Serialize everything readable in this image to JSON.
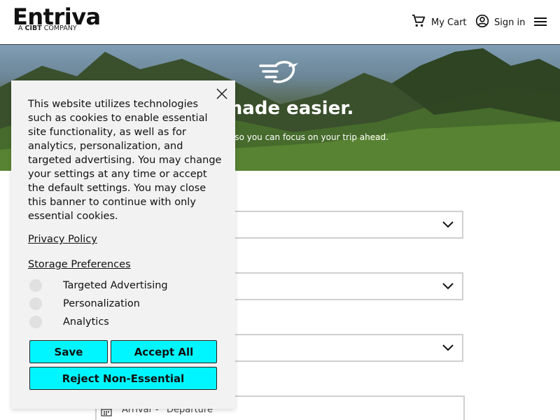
{
  "header": {
    "logo_text": "Entriva",
    "logo_sub_prefix": "A",
    "logo_sub_brand": "CIBT",
    "logo_sub_suffix": "COMPANY",
    "cart_label": "My Cart",
    "signin_label": "Sign in",
    "icons": {
      "cart": "cart-icon",
      "user": "user-circle-icon",
      "menu": "hamburger-menu-icon"
    }
  },
  "hero": {
    "title": "s made easier.",
    "subtitle": "business visas so you can focus on your trip ahead.",
    "icon": "bird-logo-icon"
  },
  "form": {
    "date": {
      "arrival_label": "Arrival",
      "separator": "-",
      "departure_label": "Departure"
    }
  },
  "cookie_banner": {
    "text": "This website utilizes technologies such as cookies to enable essential site functionality, as well as for analytics, personalization, and targeted advertising. You may change your settings at any time or accept the default settings. You may close this banner to continue with only essential cookies.",
    "privacy_link": "Privacy Policy",
    "storage_link": "Storage Preferences",
    "toggles": [
      {
        "label": "Targeted Advertising",
        "on": false
      },
      {
        "label": "Personalization",
        "on": false
      },
      {
        "label": "Analytics",
        "on": false
      }
    ],
    "save_label": "Save",
    "accept_label": "Accept All",
    "reject_label": "Reject Non-Essential"
  },
  "colors": {
    "button_accent": "#00f6ff",
    "banner_bg": "#f2f2f2",
    "field_border": "#cfcfcf"
  }
}
